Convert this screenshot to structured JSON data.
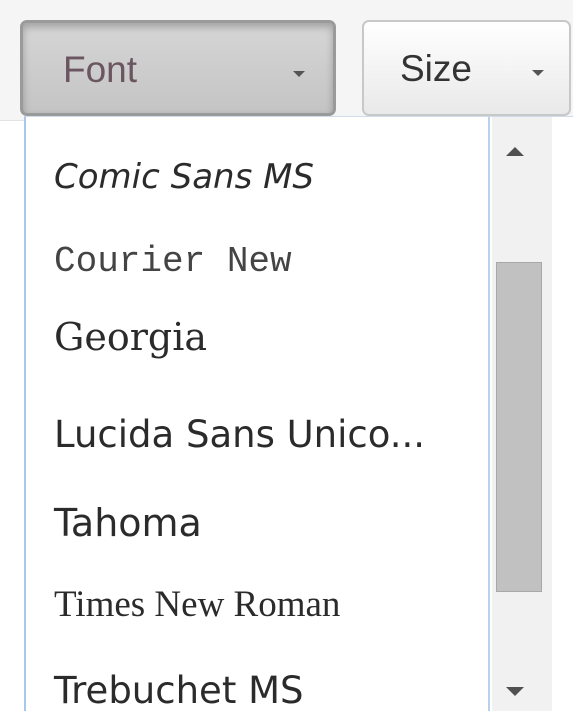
{
  "toolbar": {
    "font_label": "Font",
    "size_label": "Size"
  },
  "dropdown": {
    "items": [
      {
        "label": "Comic Sans MS"
      },
      {
        "label": "Courier New"
      },
      {
        "label": "Georgia"
      },
      {
        "label": "Lucida Sans Unico..."
      },
      {
        "label": "Tahoma"
      },
      {
        "label": "Times New Roman"
      },
      {
        "label": "Trebuchet MS"
      }
    ]
  },
  "colors": {
    "toolbar_bg": "#f5f5f5",
    "active_button_bg": "#c8c8c8",
    "dropdown_border": "#a9c7ea",
    "scroll_thumb": "#c1c1c1"
  },
  "icons": {
    "caret": "chevron-down-icon",
    "scroll_up": "arrow-up-icon",
    "scroll_down": "arrow-down-icon"
  }
}
